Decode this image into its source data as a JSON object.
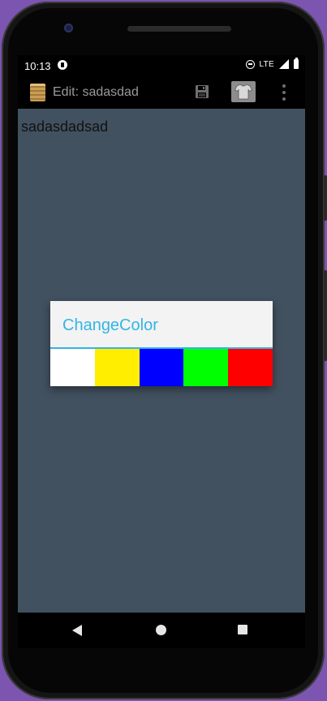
{
  "status_bar": {
    "time": "10:13",
    "network": "LTE"
  },
  "toolbar": {
    "title": "Edit: sadasdad",
    "icons": [
      "notebook-icon",
      "save-icon",
      "shirt-icon",
      "overflow-menu-icon"
    ]
  },
  "editor": {
    "text": "sadasdadsad",
    "background_color": "#425160"
  },
  "dialog": {
    "title": "ChangeColor",
    "accent_color": "#33b5e5",
    "swatches": [
      {
        "name": "white",
        "color": "#ffffff"
      },
      {
        "name": "yellow",
        "color": "#ffee00"
      },
      {
        "name": "blue",
        "color": "#0000ff"
      },
      {
        "name": "green",
        "color": "#00ff00"
      },
      {
        "name": "red",
        "color": "#ff0000"
      }
    ]
  },
  "nav_bar": {
    "icons": [
      "back-icon",
      "home-icon",
      "recents-icon"
    ]
  }
}
